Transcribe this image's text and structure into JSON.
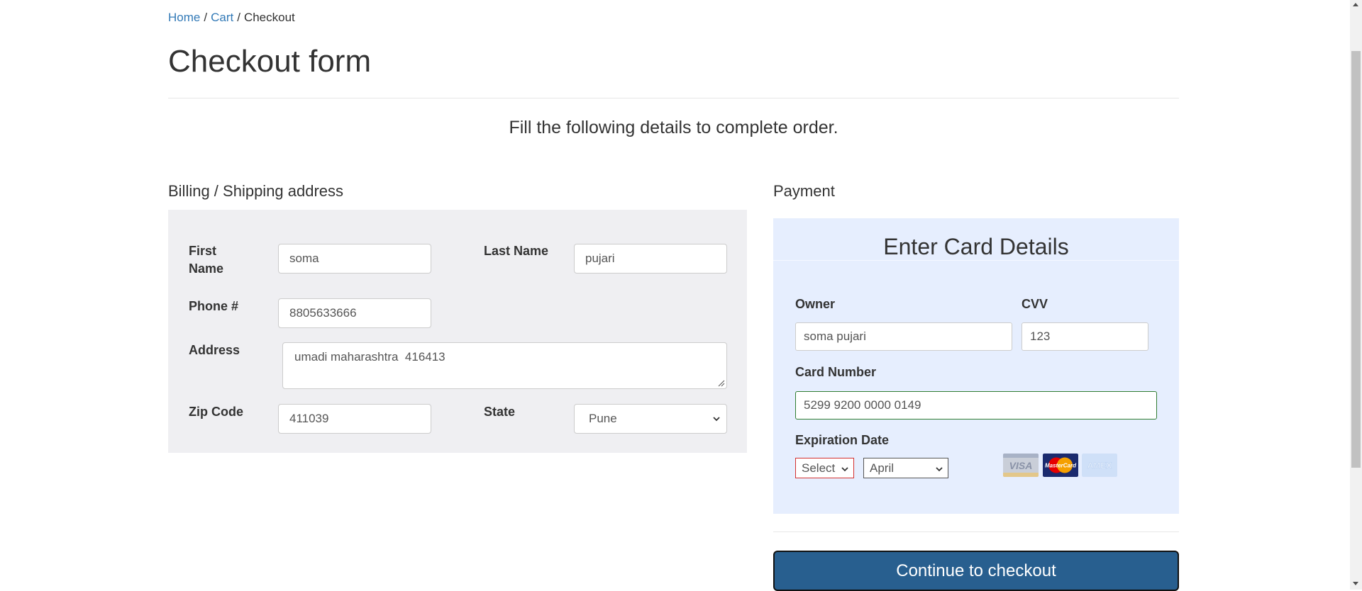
{
  "breadcrumb": {
    "home": "Home",
    "cart": "Cart",
    "current": "Checkout",
    "separator": "/"
  },
  "page": {
    "title": "Checkout form",
    "lead": "Fill the following details to complete order."
  },
  "billing": {
    "heading": "Billing / Shipping address",
    "first_name_label": "First Name",
    "first_name_value": "soma",
    "last_name_label": "Last Name",
    "last_name_value": "pujari",
    "phone_label": "Phone #",
    "phone_value": "8805633666",
    "address_label": "Address",
    "address_value": "umadi maharashtra  416413",
    "zip_label": "Zip Code",
    "zip_value": "411039",
    "state_label": "State",
    "state_value": "Pune"
  },
  "payment": {
    "heading": "Payment",
    "card_title": "Enter Card Details",
    "owner_label": "Owner",
    "owner_value": "soma pujari",
    "cvv_label": "CVV",
    "cvv_value": "123",
    "card_number_label": "Card Number",
    "card_number_value": "5299 9200 0000 0149",
    "expiration_label": "Expiration Date",
    "year_select_value": "Select",
    "month_select_value": "April",
    "visa_text": "VISA",
    "mastercard_text": "MasterCard",
    "amex_text": "AMEX"
  },
  "actions": {
    "continue_label": "Continue to checkout"
  },
  "colors": {
    "link": "#337ab7",
    "billing_panel_bg": "#efeff2",
    "payment_panel_bg": "#e6eefe",
    "button_bg": "#285f8f",
    "valid_border": "#2f7d32",
    "invalid_border": "#d32f2f"
  },
  "icons": {
    "resize": "resize-grip-icon",
    "dropdown": "chevron-down-icon",
    "visa": "visa-logo-icon",
    "mastercard": "mastercard-logo-icon",
    "amex": "amex-logo-icon"
  }
}
